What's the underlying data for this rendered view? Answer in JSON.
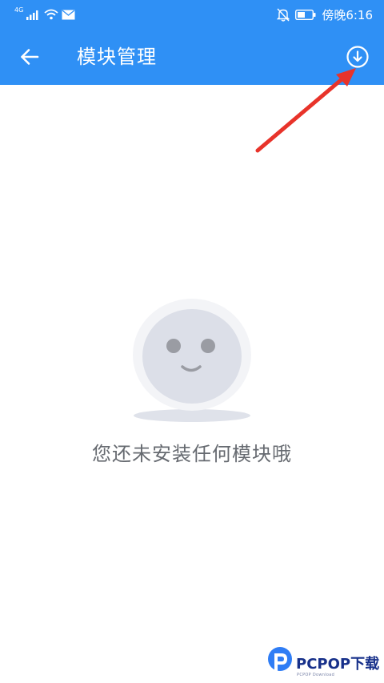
{
  "status_bar": {
    "network": "4G",
    "time": "傍晚6:16",
    "icons": [
      "signal-icon",
      "wifi-icon",
      "mail-icon",
      "notifications-off-icon",
      "battery-icon"
    ]
  },
  "app_bar": {
    "title": "模块管理",
    "back_icon": "arrow-left-icon",
    "download_icon": "download-circle-icon"
  },
  "empty_state": {
    "message": "您还未安装任何模块哦",
    "illustration": "smiley-face-illustration"
  },
  "annotation": {
    "arrow_color": "#e8332a"
  },
  "watermark": {
    "brand": "PCPOP下载",
    "subtitle": "PCPOP Download"
  },
  "colors": {
    "primary": "#2f90f5",
    "background": "#ffffff",
    "text_secondary": "#666a70"
  }
}
